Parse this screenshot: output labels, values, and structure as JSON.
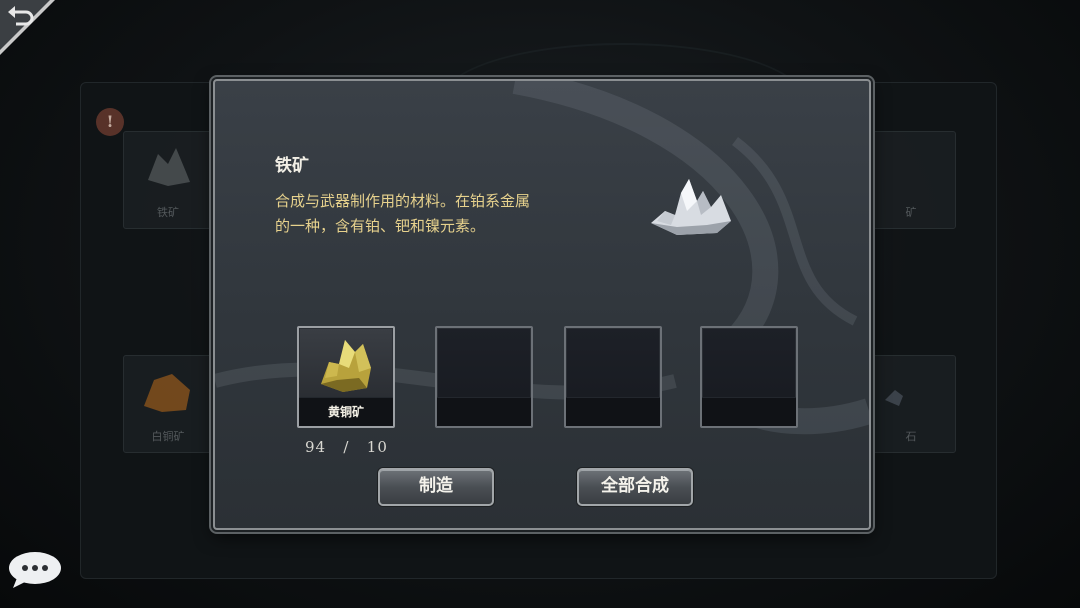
{
  "background": {
    "slot_labels": [
      "铁矿",
      "矿",
      "白铜矿",
      "石"
    ],
    "alert": "!"
  },
  "dialog": {
    "title": "铁矿",
    "description_line1": "合成与武器制作用的材料。在铂系金属",
    "description_line2": "的一种，含有铂、钯和镍元素。",
    "preview_icon": "iron-ore-icon",
    "slots": [
      {
        "name": "黄铜矿",
        "icon": "brass-ore-icon",
        "filled": true
      },
      {
        "name": "",
        "filled": false
      },
      {
        "name": "",
        "filled": false
      },
      {
        "name": "",
        "filled": false
      }
    ],
    "counter": {
      "have": "94",
      "separator": "/",
      "need": "10"
    },
    "buttons": {
      "craft": "制造",
      "combine_all": "全部合成"
    }
  },
  "icons": {
    "back": "back-arrow-icon",
    "chat": "chat-bubble-icon"
  },
  "colors": {
    "description_text": "#e7d28d",
    "title_text": "#f2efe6"
  }
}
